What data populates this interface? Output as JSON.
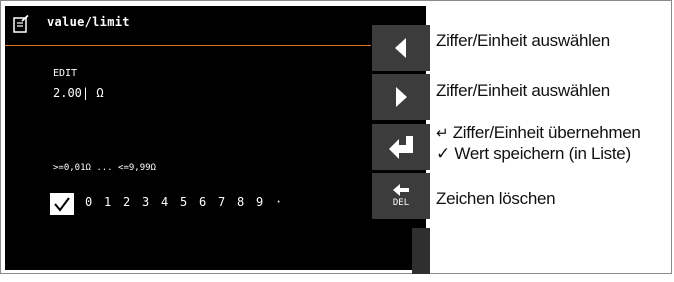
{
  "header": {
    "title": "value/limit"
  },
  "editor": {
    "mode_label": "EDIT",
    "current_value": "2.00| Ω",
    "range_text": ">=0,01Ω ... <=9,99Ω",
    "digits": [
      "0",
      "1",
      "2",
      "3",
      "4",
      "5",
      "6",
      "7",
      "8",
      "9",
      "·"
    ]
  },
  "buttons": {
    "del_label": "DEL"
  },
  "descriptions": {
    "left_arrow": "Ziffer/Einheit auswählen",
    "right_arrow": "Ziffer/Einheit auswählen",
    "enter_line1_symbol": "↵",
    "enter_line1": "Ziffer/Einheit übernehmen",
    "enter_line2_symbol": "✓",
    "enter_line2": "Wert speichern (in Liste)",
    "delete": "Zeichen löschen"
  },
  "colors": {
    "screen_bg": "#000000",
    "accent_line": "#d9731c",
    "button_bg": "#3c3c3c",
    "text_on_screen": "#ffffff"
  }
}
